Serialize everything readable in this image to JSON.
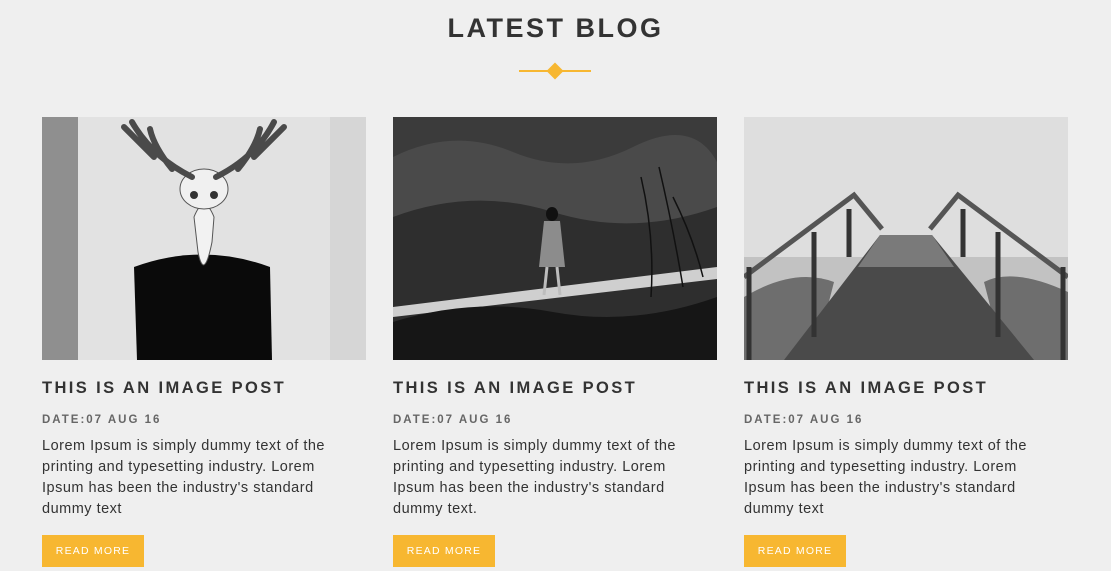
{
  "section": {
    "title": "LATEST BLOG",
    "accent_color": "#f7b731"
  },
  "posts": [
    {
      "title": "THIS IS AN IMAGE POST",
      "date": "DATE:07 AUG 16",
      "excerpt": "Lorem Ipsum is simply dummy text of the printing and typesetting industry. Lorem Ipsum has been the industry's standard dummy text",
      "button_label": "READ MORE",
      "image_subject": "deer-skull-head-photo"
    },
    {
      "title": "THIS IS AN IMAGE POST",
      "date": "DATE:07 AUG 16",
      "excerpt": "Lorem Ipsum is simply dummy text of the printing and typesetting industry. Lorem Ipsum has been the industry's standard dummy text.",
      "button_label": "READ MORE",
      "image_subject": "woman-on-mountain-path-photo"
    },
    {
      "title": "THIS IS AN IMAGE POST",
      "date": "DATE:07 AUG 16",
      "excerpt": "Lorem Ipsum is simply dummy text of the printing and typesetting industry. Lorem Ipsum has been the industry's standard dummy text",
      "button_label": "READ MORE",
      "image_subject": "foggy-wooden-bridge-photo"
    }
  ]
}
